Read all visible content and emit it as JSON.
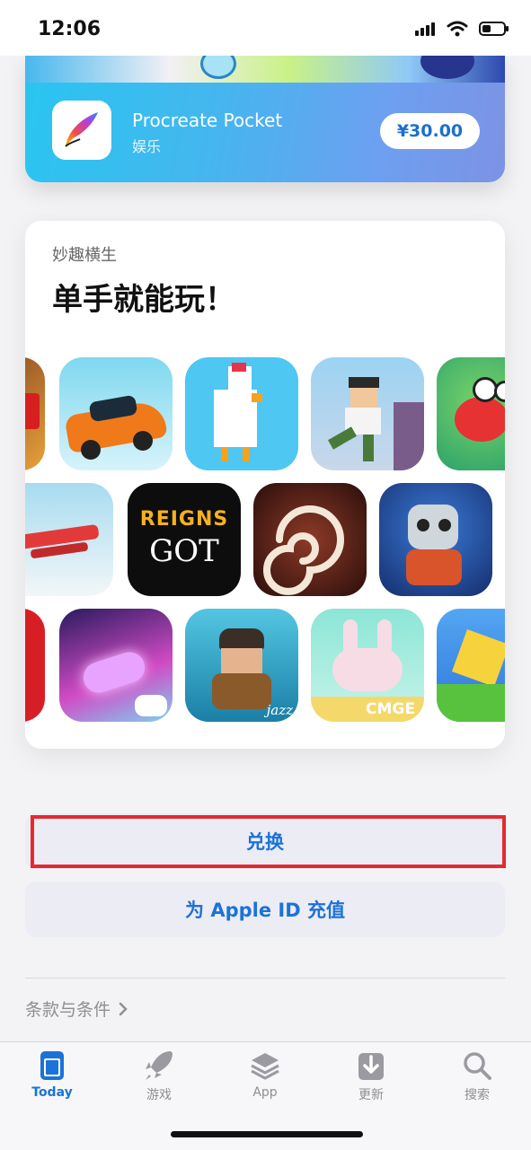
{
  "status": {
    "time": "12:06"
  },
  "featured_app": {
    "name": "Procreate Pocket",
    "category": "娱乐",
    "price": "¥30.00"
  },
  "collection": {
    "eyebrow": "妙趣横生",
    "title": "单手就能玩！",
    "apps_row2_label": "REIGNS GOT",
    "badge_jazz": "jazz",
    "badge_cmge": "CMGE"
  },
  "buttons": {
    "redeem": "兑换",
    "topup": "为 Apple ID 充值"
  },
  "terms": {
    "label": "条款与条件"
  },
  "tabs": [
    {
      "label": "Today",
      "icon": "today-icon",
      "active": true
    },
    {
      "label": "游戏",
      "icon": "rocket-icon",
      "active": false
    },
    {
      "label": "App",
      "icon": "layers-icon",
      "active": false
    },
    {
      "label": "更新",
      "icon": "download-tray-icon",
      "active": false
    },
    {
      "label": "搜索",
      "icon": "search-icon",
      "active": false
    }
  ],
  "colors": {
    "accent": "#1b72d8",
    "highlight": "#e52a2f"
  }
}
